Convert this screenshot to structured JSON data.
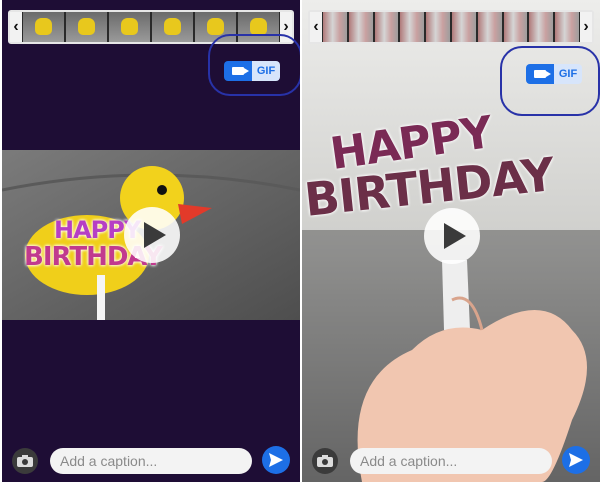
{
  "panels": [
    {
      "id": "left",
      "toggle": {
        "video_icon": "video-camera-icon",
        "gif_label": "GIF"
      },
      "sticker_line1": "HAPPY",
      "sticker_line2": "BIRTHDAY",
      "caption_placeholder": "Add a caption...",
      "trim_prev": "‹",
      "trim_next": "›"
    },
    {
      "id": "right",
      "toggle": {
        "video_icon": "video-camera-icon",
        "gif_label": "GIF"
      },
      "sticker_line1": "HAPPY",
      "sticker_line2": "BIRTHDAY",
      "caption_placeholder": "Add a caption...",
      "trim_prev": "‹",
      "trim_next": "›"
    }
  ],
  "colors": {
    "accent": "#1d6fe6",
    "highlight_ring": "#2832a8",
    "left_bg": "#1e0d35"
  }
}
